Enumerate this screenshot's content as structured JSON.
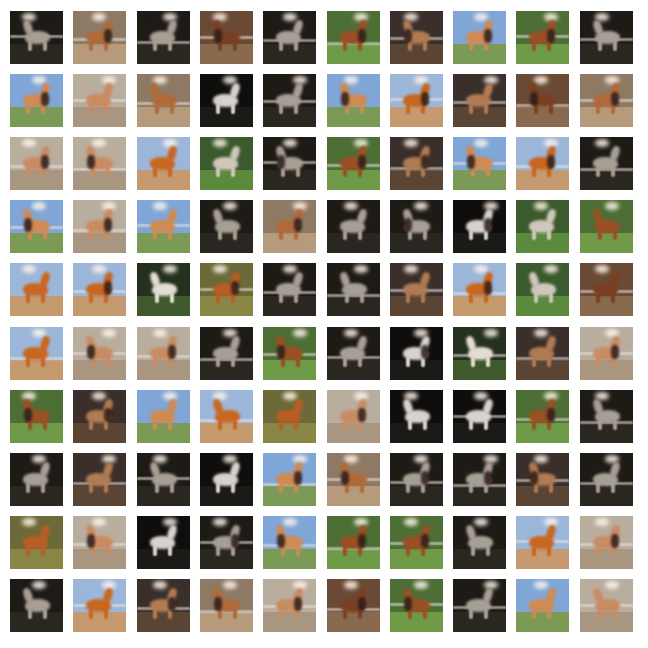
{
  "grid": {
    "rows": 10,
    "cols": 10
  },
  "palettes": {
    "dark": {
      "bg": "#1e1b17",
      "ground": "#2a2620",
      "horse": "#a89f94"
    },
    "night": {
      "bg": "#0f0e0d",
      "ground": "#1c1a17",
      "horse": "#d7d3cc"
    },
    "sky": {
      "bg": "#7fa6d6",
      "ground": "#7a9a55",
      "horse": "#d08a52"
    },
    "skyo": {
      "bg": "#9cb6d9",
      "ground": "#c59a6e",
      "horse": "#c9661f"
    },
    "green": {
      "bg": "#4d6e35",
      "ground": "#6f9a47",
      "horse": "#9b4f24"
    },
    "greenw": {
      "bg": "#3b5a2d",
      "ground": "#5b8a3c",
      "horse": "#cfc7ba"
    },
    "brown": {
      "bg": "#6b4a35",
      "ground": "#8a6a4e",
      "horse": "#7a3f22"
    },
    "sand": {
      "bg": "#8e7a64",
      "ground": "#b59a7c",
      "horse": "#b06a3a"
    },
    "olive": {
      "bg": "#6b6a38",
      "ground": "#8a8646",
      "horse": "#b85e23"
    },
    "pale": {
      "bg": "#b9ad9e",
      "ground": "#a89680",
      "horse": "#c98b62"
    },
    "forest": {
      "bg": "#26301f",
      "ground": "#3e5a2c",
      "horse": "#e3ddd3"
    },
    "dusk": {
      "bg": "#3a2f2a",
      "ground": "#5a4535",
      "horse": "#b07a52"
    }
  },
  "tiles": [
    {
      "p": "dark",
      "r": 0,
      "b": 1
    },
    {
      "p": "sand",
      "r": 1,
      "b": 1
    },
    {
      "p": "dark",
      "r": 0,
      "b": 1
    },
    {
      "p": "brown",
      "r": 1,
      "b": 1
    },
    {
      "p": "dark",
      "r": 0,
      "b": 1
    },
    {
      "p": "green",
      "r": 1,
      "b": 1
    },
    {
      "p": "dusk",
      "r": 1,
      "b": 1
    },
    {
      "p": "sky",
      "r": 1,
      "b": 0
    },
    {
      "p": "green",
      "r": 1,
      "b": 1
    },
    {
      "p": "dark",
      "r": 0,
      "b": 1
    },
    {
      "p": "sky",
      "r": 1,
      "b": 0
    },
    {
      "p": "pale",
      "r": 0,
      "b": 1
    },
    {
      "p": "sand",
      "r": 0,
      "b": 1
    },
    {
      "p": "night",
      "r": 0,
      "b": 0
    },
    {
      "p": "dark",
      "r": 0,
      "b": 1
    },
    {
      "p": "sky",
      "r": 1,
      "b": 0
    },
    {
      "p": "skyo",
      "r": 1,
      "b": 1
    },
    {
      "p": "dusk",
      "r": 0,
      "b": 1
    },
    {
      "p": "brown",
      "r": 1,
      "b": 1
    },
    {
      "p": "sand",
      "r": 1,
      "b": 1
    },
    {
      "p": "pale",
      "r": 1,
      "b": 1
    },
    {
      "p": "pale",
      "r": 1,
      "b": 1
    },
    {
      "p": "skyo",
      "r": 0,
      "b": 0
    },
    {
      "p": "greenw",
      "r": 0,
      "b": 0
    },
    {
      "p": "dark",
      "r": 1,
      "b": 1
    },
    {
      "p": "green",
      "r": 1,
      "b": 1
    },
    {
      "p": "dusk",
      "r": 1,
      "b": 1
    },
    {
      "p": "sky",
      "r": 1,
      "b": 1
    },
    {
      "p": "skyo",
      "r": 1,
      "b": 1
    },
    {
      "p": "dark",
      "r": 0,
      "b": 1
    },
    {
      "p": "sky",
      "r": 1,
      "b": 1
    },
    {
      "p": "pale",
      "r": 1,
      "b": 1
    },
    {
      "p": "sky",
      "r": 0,
      "b": 1
    },
    {
      "p": "dark",
      "r": 0,
      "b": 0
    },
    {
      "p": "sand",
      "r": 1,
      "b": 0
    },
    {
      "p": "dark",
      "r": 0,
      "b": 0
    },
    {
      "p": "dark",
      "r": 1,
      "b": 0
    },
    {
      "p": "night",
      "r": 1,
      "b": 0
    },
    {
      "p": "greenw",
      "r": 0,
      "b": 0
    },
    {
      "p": "green",
      "r": 0,
      "b": 0
    },
    {
      "p": "skyo",
      "r": 0,
      "b": 0
    },
    {
      "p": "skyo",
      "r": 1,
      "b": 1
    },
    {
      "p": "forest",
      "r": 0,
      "b": 0
    },
    {
      "p": "olive",
      "r": 1,
      "b": 1
    },
    {
      "p": "dark",
      "r": 0,
      "b": 1
    },
    {
      "p": "dark",
      "r": 0,
      "b": 1
    },
    {
      "p": "dusk",
      "r": 0,
      "b": 1
    },
    {
      "p": "skyo",
      "r": 1,
      "b": 1
    },
    {
      "p": "greenw",
      "r": 0,
      "b": 0
    },
    {
      "p": "brown",
      "r": 0,
      "b": 1
    },
    {
      "p": "skyo",
      "r": 0,
      "b": 1
    },
    {
      "p": "pale",
      "r": 1,
      "b": 1
    },
    {
      "p": "pale",
      "r": 1,
      "b": 1
    },
    {
      "p": "dark",
      "r": 0,
      "b": 1
    },
    {
      "p": "green",
      "r": 1,
      "b": 1
    },
    {
      "p": "dark",
      "r": 0,
      "b": 1
    },
    {
      "p": "night",
      "r": 1,
      "b": 0
    },
    {
      "p": "forest",
      "r": 0,
      "b": 1
    },
    {
      "p": "dusk",
      "r": 0,
      "b": 1
    },
    {
      "p": "pale",
      "r": 1,
      "b": 1
    },
    {
      "p": "green",
      "r": 1,
      "b": 0
    },
    {
      "p": "dusk",
      "r": 1,
      "b": 0
    },
    {
      "p": "sky",
      "r": 0,
      "b": 0
    },
    {
      "p": "skyo",
      "r": 0,
      "b": 1
    },
    {
      "p": "olive",
      "r": 0,
      "b": 0
    },
    {
      "p": "pale",
      "r": 1,
      "b": 0
    },
    {
      "p": "night",
      "r": 0,
      "b": 0
    },
    {
      "p": "night",
      "r": 0,
      "b": 1
    },
    {
      "p": "green",
      "r": 1,
      "b": 1
    },
    {
      "p": "dark",
      "r": 0,
      "b": 1
    },
    {
      "p": "dark",
      "r": 0,
      "b": 0
    },
    {
      "p": "dusk",
      "r": 0,
      "b": 1
    },
    {
      "p": "dark",
      "r": 0,
      "b": 1
    },
    {
      "p": "night",
      "r": 0,
      "b": 0
    },
    {
      "p": "sky",
      "r": 1,
      "b": 1
    },
    {
      "p": "sand",
      "r": 1,
      "b": 1
    },
    {
      "p": "dark",
      "r": 1,
      "b": 1
    },
    {
      "p": "dark",
      "r": 1,
      "b": 1
    },
    {
      "p": "dusk",
      "r": 1,
      "b": 1
    },
    {
      "p": "dark",
      "r": 0,
      "b": 1
    },
    {
      "p": "olive",
      "r": 0,
      "b": 0
    },
    {
      "p": "pale",
      "r": 1,
      "b": 1
    },
    {
      "p": "night",
      "r": 0,
      "b": 0
    },
    {
      "p": "dark",
      "r": 1,
      "b": 1
    },
    {
      "p": "sky",
      "r": 1,
      "b": 1
    },
    {
      "p": "green",
      "r": 1,
      "b": 1
    },
    {
      "p": "green",
      "r": 1,
      "b": 1
    },
    {
      "p": "dark",
      "r": 0,
      "b": 0
    },
    {
      "p": "skyo",
      "r": 0,
      "b": 1
    },
    {
      "p": "pale",
      "r": 1,
      "b": 1
    },
    {
      "p": "dark",
      "r": 0,
      "b": 0
    },
    {
      "p": "skyo",
      "r": 0,
      "b": 1
    },
    {
      "p": "dusk",
      "r": 1,
      "b": 1
    },
    {
      "p": "sand",
      "r": 1,
      "b": 1
    },
    {
      "p": "pale",
      "r": 1,
      "b": 1
    },
    {
      "p": "brown",
      "r": 1,
      "b": 1
    },
    {
      "p": "green",
      "r": 1,
      "b": 1
    },
    {
      "p": "dark",
      "r": 0,
      "b": 1
    },
    {
      "p": "sky",
      "r": 0,
      "b": 0
    },
    {
      "p": "pale",
      "r": 0,
      "b": 1
    }
  ]
}
